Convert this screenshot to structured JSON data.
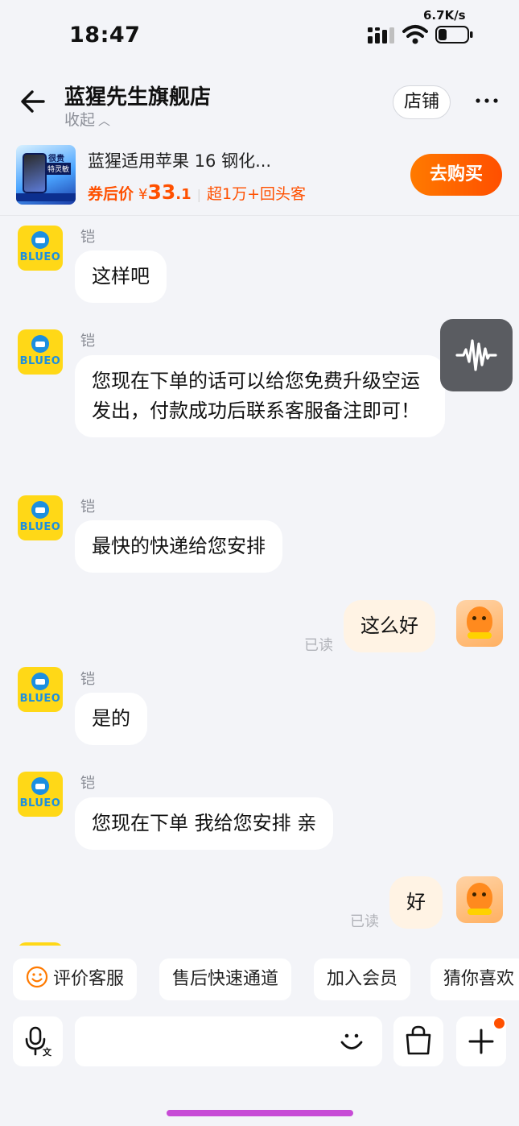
{
  "status_bar": {
    "time": "18:47",
    "net_speed": "6.7K/s"
  },
  "header": {
    "title": "蓝猩先生旗舰店",
    "collapse_label": "收起",
    "store_button": "店铺"
  },
  "product": {
    "thumb_tag1": "很贵",
    "thumb_tag2": "特灵敏",
    "name": "蓝猩适用苹果 16 钢化...",
    "price_label": "券后价",
    "currency": "¥",
    "price_int": "33",
    "price_dec": ".1",
    "repeat_buyers": "超1万+回头客",
    "buy_button": "去购买"
  },
  "agent": {
    "avatar_text": "BLUEO",
    "name": "铠"
  },
  "messages": [
    {
      "from": "agent",
      "text": "这样吧"
    },
    {
      "from": "agent",
      "text": "您现在下单的话可以给您免费升级空运发出，付款成功后联系客服备注即可！"
    },
    {
      "from": "agent",
      "text": "最快的快递给您安排"
    },
    {
      "from": "me",
      "text": "这么好",
      "status": "已读"
    },
    {
      "from": "agent",
      "text": "是的"
    },
    {
      "from": "agent",
      "text": "您现在下单 我给您安排 亲"
    },
    {
      "from": "me",
      "text": "好",
      "status": "已读"
    }
  ],
  "quick_chips": [
    "评价客服",
    "售后快速通道",
    "加入会员",
    "猜你喜欢"
  ],
  "icons": {
    "back": "arrow-left-icon",
    "more": "more-icon",
    "voice": "soundwave-icon",
    "mic": "mic-translate-icon",
    "emoji": "emoji-icon",
    "bag": "shopping-bag-icon",
    "plus": "plus-icon"
  },
  "colors": {
    "accent": "#ff5000",
    "background": "#f3f4f8",
    "my_bubble": "#fff3e4",
    "agent_avatar": "#ffd817"
  }
}
